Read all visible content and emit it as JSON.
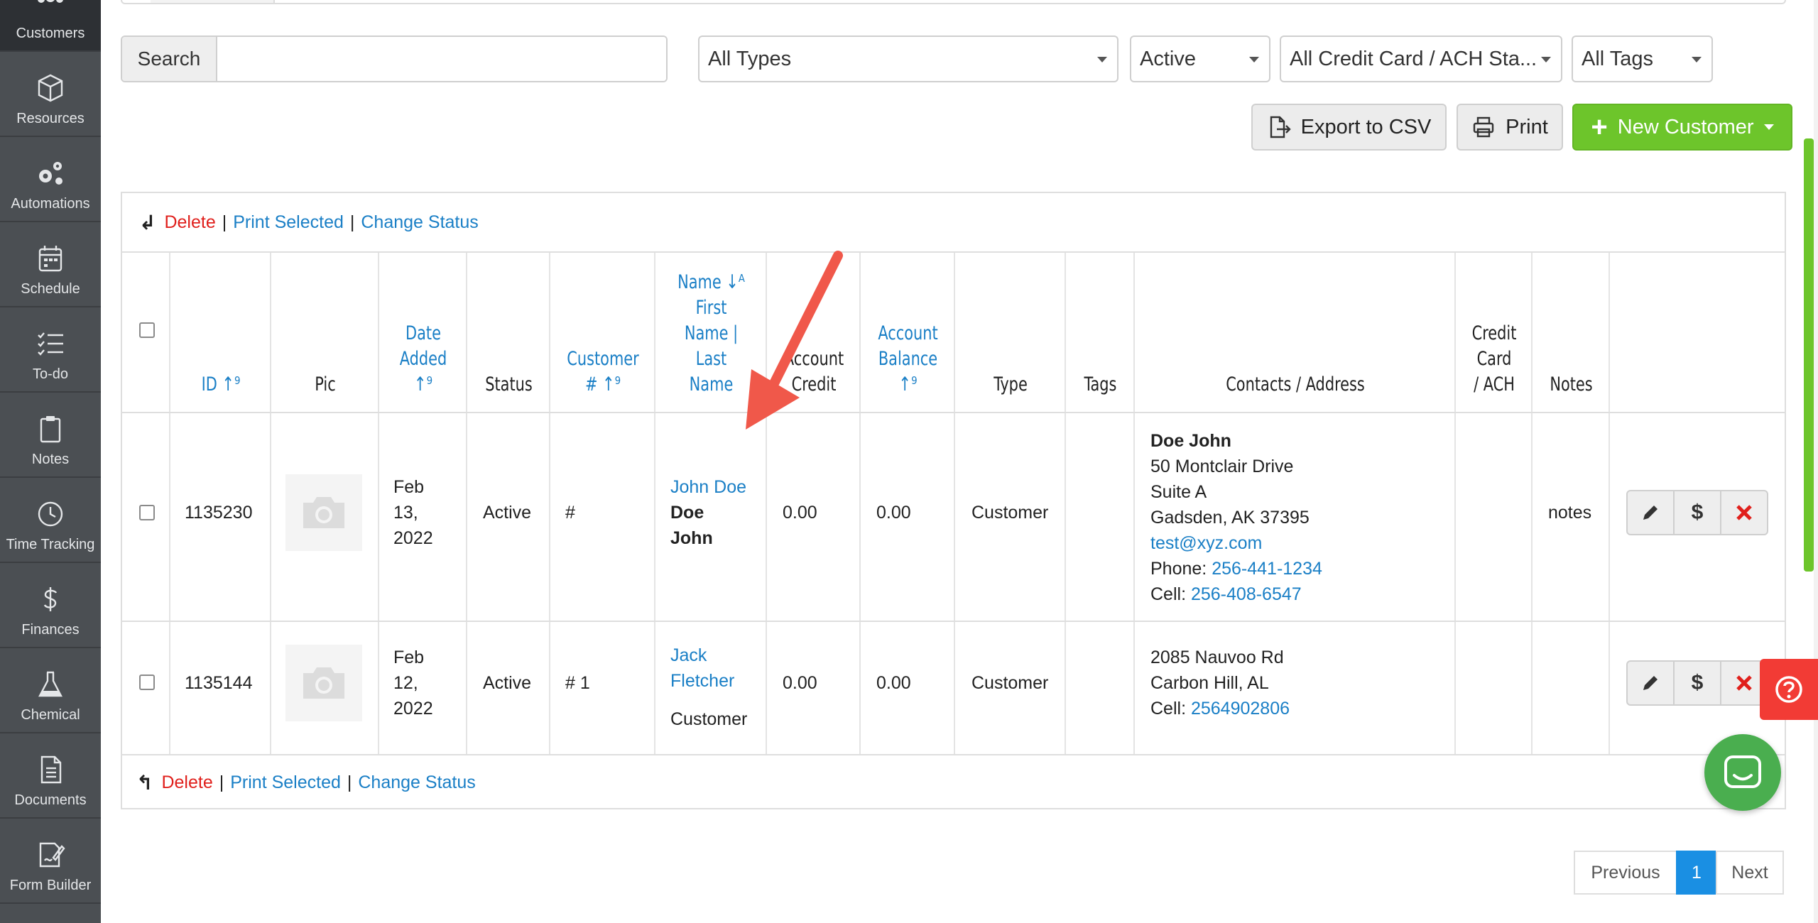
{
  "sidebar": {
    "items": [
      {
        "label": "Customers",
        "icon": "users-icon"
      },
      {
        "label": "Resources",
        "icon": "cube-icon"
      },
      {
        "label": "Automations",
        "icon": "gears-icon"
      },
      {
        "label": "Schedule",
        "icon": "calendar-icon"
      },
      {
        "label": "To-do",
        "icon": "checklist-icon"
      },
      {
        "label": "Notes",
        "icon": "clipboard-icon"
      },
      {
        "label": "Time Tracking",
        "icon": "clock-icon"
      },
      {
        "label": "Finances",
        "icon": "dollar-icon"
      },
      {
        "label": "Chemical",
        "icon": "flask-icon"
      },
      {
        "label": "Documents",
        "icon": "document-icon"
      },
      {
        "label": "Form Builder",
        "icon": "form-builder-icon"
      }
    ]
  },
  "filters": {
    "search_label": "Search",
    "search_value": "",
    "type": "All Types",
    "status": "Active",
    "card_status": "All Credit Card / ACH Sta...",
    "tags": "All Tags"
  },
  "actions": {
    "export": "Export to CSV",
    "print": "Print",
    "new_customer": "New Customer"
  },
  "bulk": {
    "delete": "Delete",
    "print_selected": "Print Selected",
    "change_status": "Change Status",
    "sep": "|"
  },
  "table": {
    "headers": {
      "id": "ID ↑⁹",
      "pic": "Pic",
      "date_added_1": "Date",
      "date_added_2": "Added",
      "date_added_3": "↑⁹",
      "status": "Status",
      "customer_no_1": "Customer",
      "customer_no_2": "# ↑⁹",
      "name_1": "Name ↓ᴬ",
      "name_2": "First",
      "name_3": "Name |",
      "name_4": "Last",
      "name_5": "Name",
      "account_credit_1": "Account",
      "account_credit_2": "Credit",
      "account_balance_1": "Account",
      "account_balance_2": "Balance",
      "account_balance_3": "↑⁹",
      "type": "Type",
      "tags": "Tags",
      "contacts": "Contacts / Address",
      "card_1": "Credit",
      "card_2": "Card",
      "card_3": "/ ACH",
      "notes": "Notes"
    },
    "rows": [
      {
        "id": "1135230",
        "date_1": "Feb",
        "date_2": "13,",
        "date_3": "2022",
        "status": "Active",
        "customer_no": "#",
        "name_link": "John Doe",
        "name_bold_1": "Doe",
        "name_bold_2": "John",
        "account_credit": "0.00",
        "account_balance": "0.00",
        "type": "Customer",
        "contact_name": "Doe John",
        "address_1": "50 Montclair Drive",
        "address_2": "Suite A",
        "address_3": "Gadsden, AK 37395",
        "email": "test@xyz.com",
        "phone_label": "Phone:",
        "phone": "256-441-1234",
        "cell_label": "Cell:",
        "cell": "256-408-6547",
        "notes": "notes"
      },
      {
        "id": "1135144",
        "date_1": "Feb",
        "date_2": "12,",
        "date_3": "2022",
        "status": "Active",
        "customer_no": "# 1",
        "name_link_1": "Jack",
        "name_link_2": "Fletcher",
        "name_sub": "Customer",
        "account_credit": "0.00",
        "account_balance": "0.00",
        "type": "Customer",
        "address_1": "2085 Nauvoo Rd",
        "address_2": "Carbon Hill, AL",
        "cell_label": "Cell:",
        "cell": "2564902806"
      }
    ]
  },
  "pagination": {
    "previous": "Previous",
    "current": "1",
    "next": "Next"
  },
  "colors": {
    "green": "#6dc52b",
    "link": "#1a7fc6",
    "danger": "#e0201c",
    "annotation": "#f0584a"
  }
}
